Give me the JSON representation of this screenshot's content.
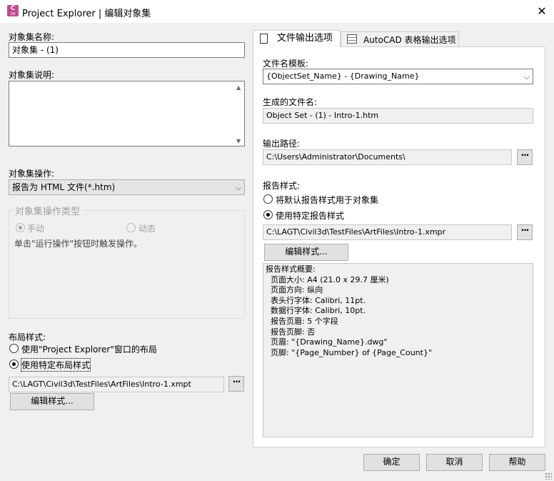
{
  "window": {
    "title": "Project Explorer | 编辑对象集",
    "app_icon_label": "C",
    "app_icon_sublabel": "3D",
    "close_glyph": "✕"
  },
  "left": {
    "name_label": "对象集名称:",
    "name_value": "对象集 - (1)",
    "desc_label": "对象集说明:",
    "desc_value": "",
    "op_label": "对象集操作:",
    "op_value": "报告为 HTML 文件(*.htm)",
    "op_type_group": "对象集操作类型",
    "op_type_manual": "手动",
    "op_type_dynamic": "动态",
    "op_type_hint": "单击\"运行操作\"按钮时触发操作。",
    "layout_label": "布局样式:",
    "layout_opt1": "使用\"Project Explorer\"窗口的布局",
    "layout_opt2": "使用特定布局样式",
    "layout_path": "C:\\LAGT\\Civil3d\\TestFiles\\ArtFiles\\Intro-1.xmpt",
    "edit_style_button": "编辑样式...",
    "browse_glyph": "···"
  },
  "tabs": [
    {
      "label": "文件输出选项"
    },
    {
      "label": "AutoCAD 表格输出选项"
    }
  ],
  "right": {
    "template_label": "文件名模板:",
    "template_value": "{ObjectSet_Name} - {Drawing_Name}",
    "generated_label": "生成的文件名:",
    "generated_value": "Object Set - (1) - Intro-1.htm",
    "output_label": "输出路径:",
    "output_value": "C:\\Users\\Administrator\\Documents\\",
    "report_label": "报告样式:",
    "report_opt1": "将默认报告样式用于对象集",
    "report_opt2": "使用特定报告样式",
    "report_path": "C:\\LAGT\\Civil3d\\TestFiles\\ArtFiles\\Intro-1.xmpr",
    "edit_style_button": "编辑样式...",
    "summary": [
      "报告样式概要:",
      "  页面大小: A4 (21.0 x 29.7 厘米)",
      "  页面方向: 纵向",
      "  表头行字体: Calibri, 11pt.",
      "  数据行字体: Calibri, 10pt.",
      "  报告页眉: 5 个字段",
      "  报告页脚: 否",
      "  页眉: \"{Drawing_Name}.dwg\"",
      "  页脚: \"{Page_Number} of {Page_Count}\""
    ]
  },
  "footer": {
    "ok": "确定",
    "cancel": "取消",
    "help": "帮助"
  },
  "colors": {
    "app_icon": "#c04b8e",
    "dialog_bg": "#f0f0f0"
  }
}
